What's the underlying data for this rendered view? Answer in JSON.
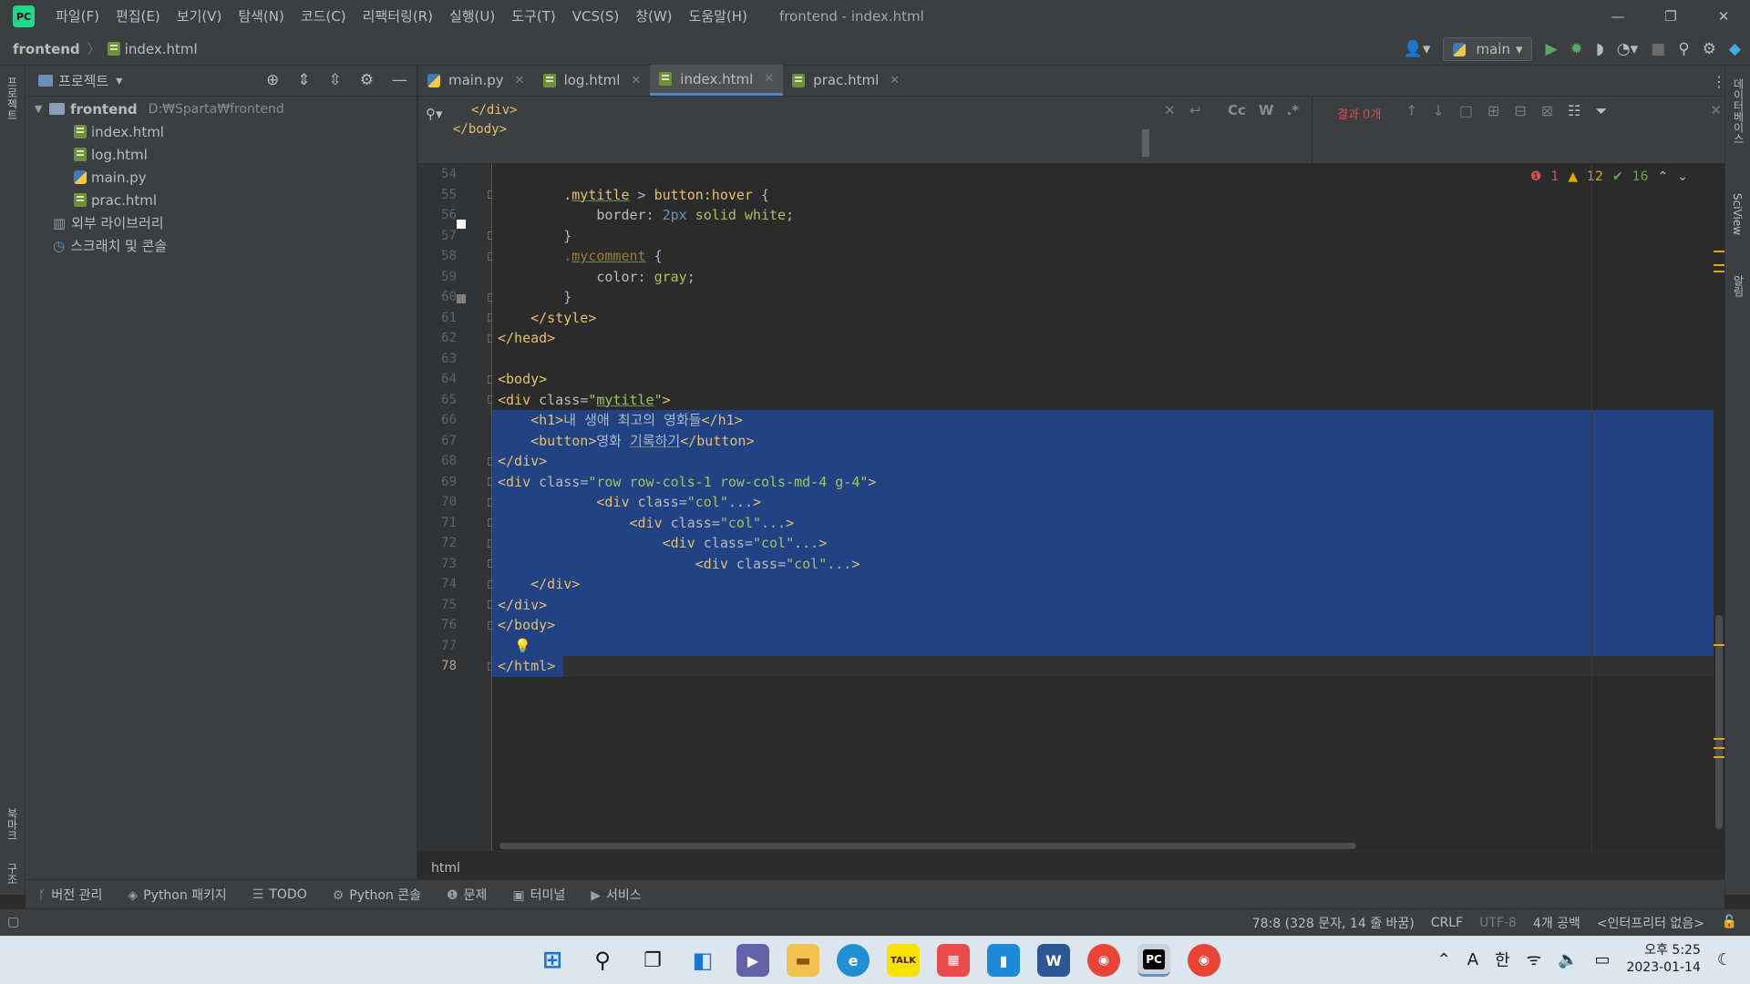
{
  "window": {
    "title": "frontend - index.html",
    "menu": [
      "파일(F)",
      "편집(E)",
      "보기(V)",
      "탐색(N)",
      "코드(C)",
      "리팩터링(R)",
      "실행(U)",
      "도구(T)",
      "VCS(S)",
      "창(W)",
      "도움말(H)"
    ],
    "controls": [
      "—",
      "❐",
      "✕"
    ]
  },
  "navbar": {
    "project": "frontend",
    "file": "index.html",
    "run_config": "main"
  },
  "left_strip": {
    "project_label": "프로젝트",
    "bookmarks_label": "북마크",
    "structure_label": "구조"
  },
  "right_strip": {
    "db_label": "데이터베이스",
    "sciview_label": "SciView",
    "notifications_label": "알림"
  },
  "project_panel": {
    "title": "프로젝트",
    "root": {
      "name": "frontend",
      "path": "D:₩Sparta₩frontend"
    },
    "files": [
      {
        "name": "index.html",
        "type": "html"
      },
      {
        "name": "log.html",
        "type": "html"
      },
      {
        "name": "main.py",
        "type": "py"
      },
      {
        "name": "prac.html",
        "type": "html"
      }
    ],
    "external_libraries": "외부 라이브러리",
    "scratches": "스크래치 및 콘솔"
  },
  "tabs": [
    {
      "label": "main.py",
      "type": "py",
      "active": false
    },
    {
      "label": "log.html",
      "type": "html",
      "active": false
    },
    {
      "label": "index.html",
      "type": "html",
      "active": true
    },
    {
      "label": "prac.html",
      "type": "html",
      "active": false
    }
  ],
  "search": {
    "line1": "</div>",
    "line2": "</body>",
    "options": [
      "Cc",
      "W",
      ".*"
    ],
    "result": "결과 0개"
  },
  "inspections": {
    "errors": "1",
    "warnings": "12",
    "ok": "16"
  },
  "editor": {
    "line_numbers": [
      "54",
      "55",
      "56",
      "57",
      "58",
      "59",
      "60",
      "61",
      "62",
      "63",
      "64",
      "65",
      "66",
      "67",
      "68",
      "69",
      "70",
      "71",
      "72",
      "73",
      "74",
      "75",
      "76",
      "77",
      "78"
    ],
    "current_line": "78",
    "breadcrumb": "html"
  },
  "bottom_tools": [
    {
      "icon": "ᚴ",
      "label": "버전 관리"
    },
    {
      "icon": "◈",
      "label": "Python 패키지"
    },
    {
      "icon": "☰",
      "label": "TODO"
    },
    {
      "icon": "⚙",
      "label": "Python 콘솔"
    },
    {
      "icon": "❶",
      "label": "문제"
    },
    {
      "icon": "▣",
      "label": "터미널"
    },
    {
      "icon": "▶",
      "label": "서비스"
    }
  ],
  "status": {
    "position": "78:8 (328 문자, 14 줄 바꿈)",
    "line_sep": "CRLF",
    "encoding": "UTF-8",
    "indent": "4개 공백",
    "interpreter": "<인터프리터 없음>"
  },
  "taskbar": {
    "time": "오후 5:25",
    "date": "2023-01-14",
    "ime_a": "A",
    "ime_lang": "한"
  },
  "colors": {
    "accent": "#4a88c7",
    "selection": "#214283",
    "tag": "#e8bf6a",
    "string": "#a5c25c",
    "number": "#6897bb"
  }
}
